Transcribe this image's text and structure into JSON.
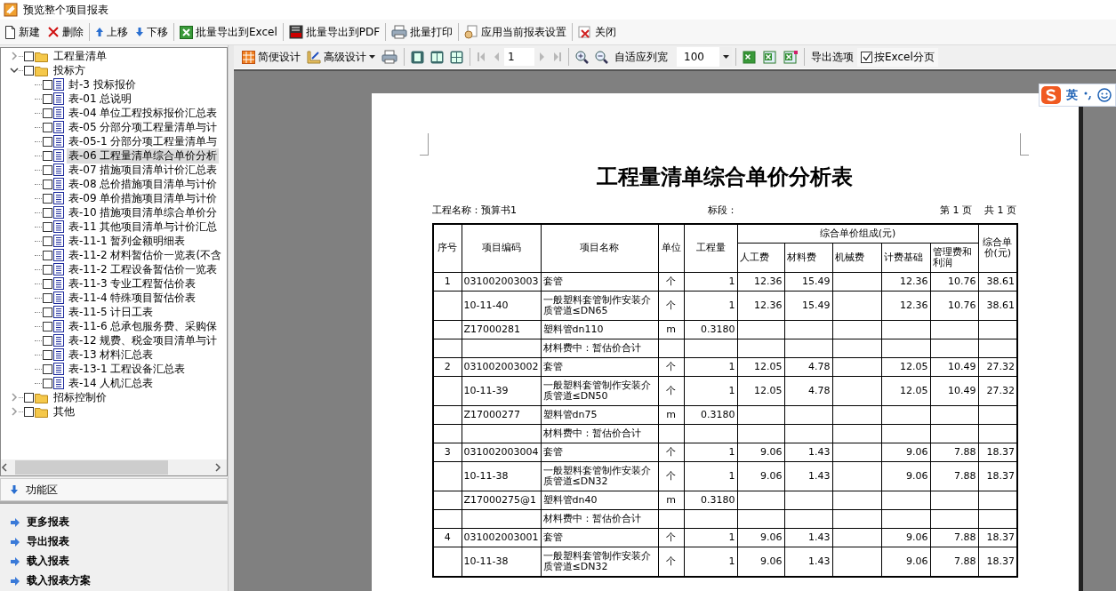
{
  "window": {
    "title": "预览整个项目报表"
  },
  "toolbar": [
    [
      {
        "label": "新建"
      },
      {
        "label": "删除"
      }
    ],
    [
      {
        "label": "上移"
      },
      {
        "label": "下移"
      }
    ],
    [
      {
        "label": "批量导出到Excel"
      }
    ],
    [
      {
        "label": "批量导出到PDF"
      }
    ],
    [
      {
        "label": "批量打印"
      }
    ],
    [
      {
        "label": "应用当前报表设置"
      }
    ],
    [
      {
        "label": "关闭"
      }
    ]
  ],
  "tree": [
    {
      "label": "工程量清单",
      "kind": "folder",
      "expanded": false,
      "checked": false,
      "selected": false
    },
    {
      "label": "投标方",
      "kind": "folder",
      "expanded": true,
      "checked": false,
      "selected": false,
      "children": [
        {
          "label": "封-3 投标报价",
          "kind": "report",
          "checked": false,
          "selected": false
        },
        {
          "label": "表-01 总说明",
          "kind": "report",
          "checked": false,
          "selected": false
        },
        {
          "label": "表-04 单位工程投标报价汇总表",
          "kind": "report",
          "checked": false,
          "selected": false
        },
        {
          "label": "表-05 分部分项工程量清单与计",
          "kind": "report",
          "checked": false,
          "selected": false
        },
        {
          "label": "表-05-1 分部分项工程量清单与",
          "kind": "report",
          "checked": false,
          "selected": false
        },
        {
          "label": "表-06 工程量清单综合单价分析",
          "kind": "report",
          "checked": false,
          "selected": true
        },
        {
          "label": "表-07 措施项目清单计价汇总表",
          "kind": "report",
          "checked": false,
          "selected": false
        },
        {
          "label": "表-08 总价措施项目清单与计价",
          "kind": "report",
          "checked": false,
          "selected": false
        },
        {
          "label": "表-09 单价措施项目清单与计价",
          "kind": "report",
          "checked": false,
          "selected": false
        },
        {
          "label": "表-10 措施项目清单综合单价分",
          "kind": "report",
          "checked": false,
          "selected": false
        },
        {
          "label": "表-11 其他项目清单与计价汇总",
          "kind": "report",
          "checked": false,
          "selected": false
        },
        {
          "label": "表-11-1 暂列金额明细表",
          "kind": "report",
          "checked": false,
          "selected": false
        },
        {
          "label": "表-11-2 材料暂估价一览表(不含",
          "kind": "report",
          "checked": false,
          "selected": false
        },
        {
          "label": "表-11-2 工程设备暂估价一览表",
          "kind": "report",
          "checked": false,
          "selected": false
        },
        {
          "label": "表-11-3 专业工程暂估价表",
          "kind": "report",
          "checked": false,
          "selected": false
        },
        {
          "label": "表-11-4 特殊项目暂估价表",
          "kind": "report",
          "checked": false,
          "selected": false
        },
        {
          "label": "表-11-5 计日工表",
          "kind": "report",
          "checked": false,
          "selected": false
        },
        {
          "label": "表-11-6 总承包服务费、采购保",
          "kind": "report",
          "checked": false,
          "selected": false
        },
        {
          "label": "表-12 规费、税金项目清单与计",
          "kind": "report",
          "checked": false,
          "selected": false
        },
        {
          "label": "表-13 材料汇总表",
          "kind": "report",
          "checked": false,
          "selected": false
        },
        {
          "label": "表-13-1 工程设备汇总表",
          "kind": "report",
          "checked": false,
          "selected": false
        },
        {
          "label": "表-14 人机汇总表",
          "kind": "report",
          "checked": false,
          "selected": false
        }
      ]
    },
    {
      "label": "招标控制价",
      "kind": "folder",
      "expanded": false,
      "checked": false,
      "selected": false
    },
    {
      "label": "其他",
      "kind": "folder",
      "expanded": false,
      "checked": false,
      "selected": false
    }
  ],
  "function_panel": {
    "title": "功能区",
    "items": [
      "更多报表",
      "导出报表",
      "载入报表",
      "载入报表方案"
    ]
  },
  "viewer_toolbar": {
    "design_buttons": [
      {
        "label": "简便设计",
        "dropdown": false
      },
      {
        "label": "高级设计",
        "dropdown": true
      }
    ],
    "page": "1",
    "nav_disabled": true,
    "fit_button": "自适应列宽",
    "zoom": "100",
    "export_options": "导出选项",
    "excel_paging": {
      "label": "按Excel分页",
      "checked": true
    }
  },
  "ime": {
    "mode": "英"
  },
  "report": {
    "title": "工程量清单综合单价分析表",
    "project": "工程名称：预算书1",
    "section": "标段：",
    "page_no": "第 1 页",
    "page_total": "共 1 页",
    "columns": [
      "序号",
      "项目编码",
      "项目名称",
      "单位",
      "工程量"
    ],
    "group": "综合单价组成(元)",
    "sub_columns": [
      "人工费",
      "材料费",
      "机械费",
      "计费基础",
      "管理费和利润"
    ],
    "last_column": "综合单价(元)",
    "rows": [
      {
        "no": "1",
        "code": "031002003003",
        "name": "套管",
        "unit": "个",
        "qty": "1",
        "labor": "12.36",
        "material": "15.49",
        "base": "12.36",
        "mgmt": "10.76",
        "price": "38.61"
      },
      {
        "code": "10-11-40",
        "name": "一般塑料套管制作安装介质管道≤DN65",
        "unit": "个",
        "qty": "1",
        "labor": "12.36",
        "material": "15.49",
        "base": "12.36",
        "mgmt": "10.76",
        "price": "38.61"
      },
      {
        "code": "Z17000281",
        "name": "塑料管dn110",
        "unit": "m",
        "qty": "0.3180"
      },
      {
        "name": "材料费中：暂估价合计"
      },
      {
        "no": "2",
        "code": "031002003002",
        "name": "套管",
        "unit": "个",
        "qty": "1",
        "labor": "12.05",
        "material": "4.78",
        "base": "12.05",
        "mgmt": "10.49",
        "price": "27.32"
      },
      {
        "code": "10-11-39",
        "name": "一般塑料套管制作安装介质管道≤DN50",
        "unit": "个",
        "qty": "1",
        "labor": "12.05",
        "material": "4.78",
        "base": "12.05",
        "mgmt": "10.49",
        "price": "27.32"
      },
      {
        "code": "Z17000277",
        "name": "塑料管dn75",
        "unit": "m",
        "qty": "0.3180"
      },
      {
        "name": "材料费中：暂估价合计"
      },
      {
        "no": "3",
        "code": "031002003004",
        "name": "套管",
        "unit": "个",
        "qty": "1",
        "labor": "9.06",
        "material": "1.43",
        "base": "9.06",
        "mgmt": "7.88",
        "price": "18.37"
      },
      {
        "code": "10-11-38",
        "name": "一般塑料套管制作安装介质管道≤DN32",
        "unit": "个",
        "qty": "1",
        "labor": "9.06",
        "material": "1.43",
        "base": "9.06",
        "mgmt": "7.88",
        "price": "18.37"
      },
      {
        "code": "Z17000275@1",
        "name": "塑料管dn40",
        "unit": "m",
        "qty": "0.3180"
      },
      {
        "name": "材料费中：暂估价合计"
      },
      {
        "no": "4",
        "code": "031002003001",
        "name": "套管",
        "unit": "个",
        "qty": "1",
        "labor": "9.06",
        "material": "1.43",
        "base": "9.06",
        "mgmt": "7.88",
        "price": "18.37"
      },
      {
        "code": "10-11-38",
        "name": "一般塑料套管制作安装介质管道≤DN32",
        "unit": "个",
        "qty": "1",
        "labor": "9.06",
        "material": "1.43",
        "base": "9.06",
        "mgmt": "7.88",
        "price": "18.37"
      }
    ]
  }
}
